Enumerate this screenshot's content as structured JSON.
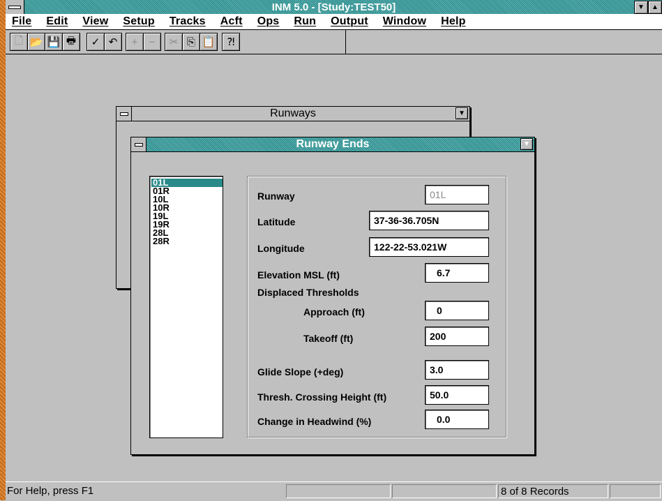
{
  "app": {
    "title": "INM 5.0 - [Study:TEST50]"
  },
  "menu": [
    "File",
    "Edit",
    "View",
    "Setup",
    "Tracks",
    "Acft",
    "Ops",
    "Run",
    "Output",
    "Window",
    "Help"
  ],
  "toolbar": {
    "new": "🗋",
    "open": "📂",
    "save": "💾",
    "print": "🖶",
    "check": "✓",
    "undo": "↶",
    "add": "+",
    "remove": "−",
    "cut": "✂",
    "copy": "⎘",
    "paste": "📋",
    "help": "⁈"
  },
  "runways_window": {
    "title": "Runways"
  },
  "runway_ends_window": {
    "title": "Runway Ends",
    "list": [
      "01L",
      "01R",
      "10L",
      "10R",
      "19L",
      "19R",
      "28L",
      "28R"
    ],
    "selected": "01L",
    "fields": {
      "runway": {
        "label": "Runway",
        "value": "01L"
      },
      "latitude": {
        "label": "Latitude",
        "value": "37-36-36.705N"
      },
      "longitude": {
        "label": "Longitude",
        "value": "122-22-53.021W"
      },
      "elevation": {
        "label": "Elevation MSL (ft)",
        "value": "6.7"
      },
      "displaced_header": "Displaced Thresholds",
      "approach": {
        "label": "Approach (ft)",
        "value": "0"
      },
      "takeoff": {
        "label": "Takeoff (ft)",
        "value": "200"
      },
      "glide_slope": {
        "label": "Glide Slope (+deg)",
        "value": "3.0"
      },
      "tch": {
        "label": "Thresh. Crossing Height (ft)",
        "value": "50.0"
      },
      "headwind": {
        "label": "Change in Headwind (%)",
        "value": "0.0"
      }
    }
  },
  "status": {
    "help": "For Help, press F1",
    "records": "8 of 8  Records"
  },
  "colors": {
    "title_teal": "#2a8a8a",
    "frame_orange": "#e08a3c",
    "face": "#c0c0c0"
  }
}
